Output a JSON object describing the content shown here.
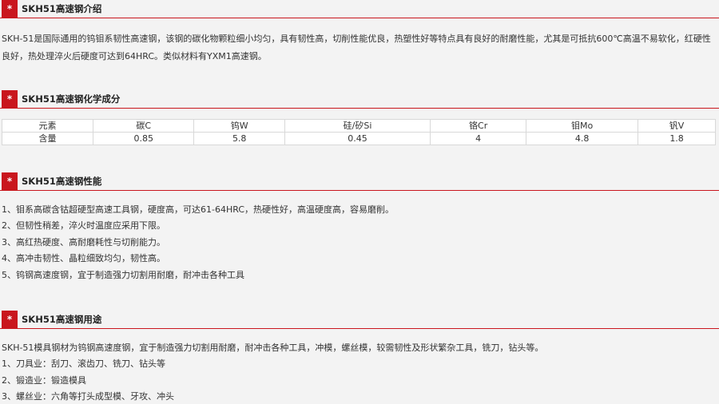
{
  "sections": {
    "intro": {
      "title": "SKH51高速钢介绍",
      "text": "SKH-51是国际通用的钨钼系韧性高速钢，该钢的碳化物颗粒细小均匀，具有韧性高，切削性能优良，热塑性好等特点具有良好的耐磨性能，尤其是可抵抗600℃高温不易软化，红硬性良好，热处理淬火后硬度可达到64HRC。类似材料有YXM1高速钢。"
    },
    "composition": {
      "title": "SKH51高速钢化学成分",
      "headers": [
        "元素",
        "碳C",
        "钨W",
        "硅/矽Si",
        "铬Cr",
        "钼Mo",
        "钒V"
      ],
      "values": [
        "含量",
        "0.85",
        "5.8",
        "0.45",
        "4",
        "4.8",
        "1.8"
      ]
    },
    "performance": {
      "title": "SKH51高速钢性能",
      "items": [
        "1、钼系高碳含钴超硬型高速工具钢，硬度高，可达61-64HRC，热硬性好，高温硬度高，容易磨削。",
        "2、但韧性稍差，淬火时温度应采用下限。",
        "3、高红热硬度、高耐磨耗性与切削能力。",
        "4、高冲击韧性、晶粒细致均匀，韧性高。",
        "5、钨钢高速度钢，宜于制造强力切割用耐磨，耐冲击各种工具"
      ]
    },
    "usage": {
      "title": "SKH51高速钢用途",
      "text": "SKH-51模具钢材为钨钢高速度钢，宜于制造强力切割用耐磨，耐冲击各种工具，冲模，螺丝模，较需韧性及形状繁杂工具，铣刀，钻头等。",
      "items": [
        "1、刀具业：刮刀、滚齿刀、铣刀、钻头等",
        "2、锻造业：锻造模具",
        "3、螺丝业：六角等打头成型模、牙攻、冲头"
      ]
    }
  },
  "star_glyph": "*",
  "accent_color": "#c9161d"
}
